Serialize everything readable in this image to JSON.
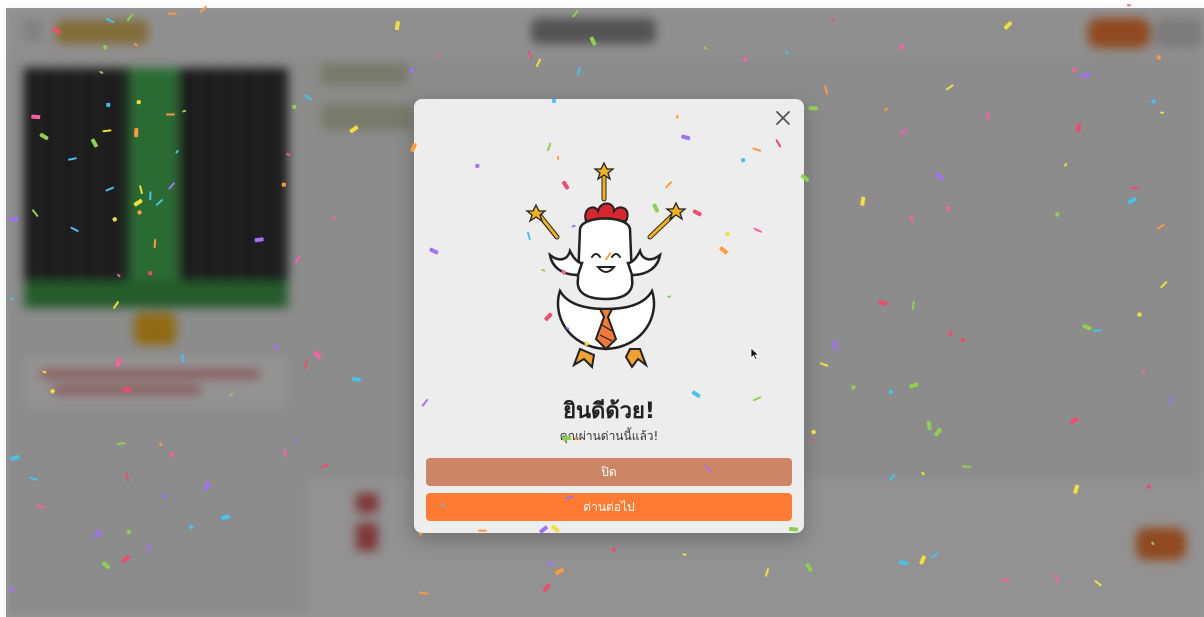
{
  "modal": {
    "title": "ยินดีด้วย!",
    "subtitle": "คุณผ่านด่านนี้แล้ว!",
    "close_label": "ปิด",
    "next_label": "ด่านต่อไป",
    "close_icon": "close-icon",
    "mascot": "chicken-mascot"
  },
  "colors": {
    "close_button": "#cc8565",
    "next_button": "#ff7a32",
    "modal_bg": "#ededed"
  }
}
